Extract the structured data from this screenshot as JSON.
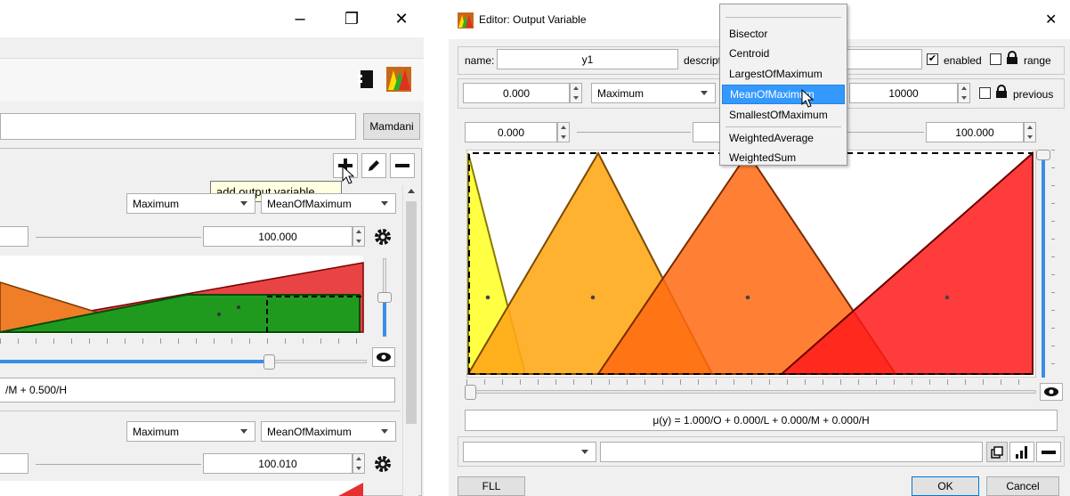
{
  "left_window": {
    "title_controls": {
      "minimize": "–",
      "restore": "❐",
      "close": "✕"
    },
    "mamdani_label": "Mamdani",
    "tooltip": "add output variable...",
    "term1": {
      "aggregation": "Maximum",
      "defuzzifier": "MeanOfMaximum",
      "max_value": "100.000",
      "formula": "/M + 0.500/H"
    },
    "term2": {
      "aggregation": "Maximum",
      "defuzzifier": "MeanOfMaximum",
      "max_value": "100.010"
    }
  },
  "editor": {
    "title": "Editor: Output Variable",
    "close": "✕",
    "name_label": "name:",
    "name_value": "y1",
    "description_label": "descripti",
    "enabled_label": "enabled",
    "range_label": "range",
    "default_value": "0.000",
    "aggregation": "Maximum",
    "resolution": "10000",
    "previous_label": "previous",
    "min_value": "0.000",
    "max_value": "100.000",
    "formula": "μ(y) = 1.000/O + 0.000/L + 0.000/M + 0.000/H",
    "fll_button": "FLL",
    "ok_button": "OK",
    "cancel_button": "Cancel"
  },
  "dropdown": {
    "items": [
      "Bisector",
      "Centroid",
      "LargestOfMaximum",
      "MeanOfMaximum",
      "SmallestOfMaximum",
      "WeightedAverage",
      "WeightedSum"
    ],
    "selected": "MeanOfMaximum"
  },
  "colors": {
    "orange": "#ff8c00",
    "red": "#ff2020",
    "green": "#22a022",
    "yellow": "#ffff33",
    "selection": "#3399ff"
  }
}
